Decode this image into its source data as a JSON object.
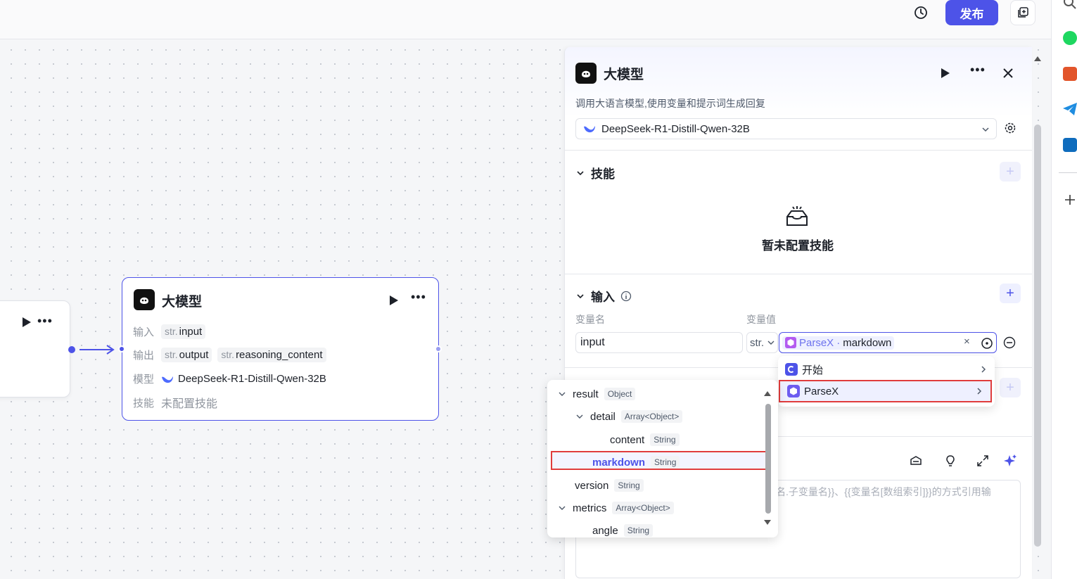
{
  "topbar": {
    "publish_label": "发布"
  },
  "canvas_node": {
    "title": "大模型",
    "input_label": "输入",
    "input_type": "str.",
    "input_name": "input",
    "output_label": "输出",
    "output_type_1": "str.",
    "output_name_1": "output",
    "output_type_2": "str.",
    "output_name_2": "reasoning_content",
    "model_label": "模型",
    "model_name": "DeepSeek-R1-Distill-Qwen-32B",
    "skill_label": "技能",
    "skill_value": "未配置技能"
  },
  "panel": {
    "title": "大模型",
    "description": "调用大语言模型,使用变量和提示词生成回复",
    "model_name": "DeepSeek-R1-Distill-Qwen-32B",
    "skills_title": "技能",
    "skills_empty": "暂未配置技能",
    "inputs_title": "输入",
    "col_var_name": "变量名",
    "col_var_value": "变量值",
    "input_name_value": "input",
    "input_type": "str.",
    "value_source": "ParseX",
    "value_sep": "·",
    "value_field": "markdown",
    "prompt_placeholder": "名.子变量名}}、{{变量名[数组索引]}}的方式引用输"
  },
  "source_menu": {
    "items": [
      {
        "label": "开始",
        "color": "#4d53e8"
      },
      {
        "label": "ParseX",
        "color": "#6d5cf0"
      }
    ]
  },
  "tree": {
    "rows": [
      {
        "name": "result",
        "type": "Object"
      },
      {
        "name": "detail",
        "type": "Array<Object>"
      },
      {
        "name": "content",
        "type": "String"
      },
      {
        "name": "markdown",
        "type": "String"
      },
      {
        "name": "version",
        "type": "String"
      },
      {
        "name": "metrics",
        "type": "Array<Object>"
      },
      {
        "name": "angle",
        "type": "String"
      }
    ]
  },
  "colors": {
    "accent": "#4d53e8",
    "highlight_border": "#e03c3c"
  }
}
